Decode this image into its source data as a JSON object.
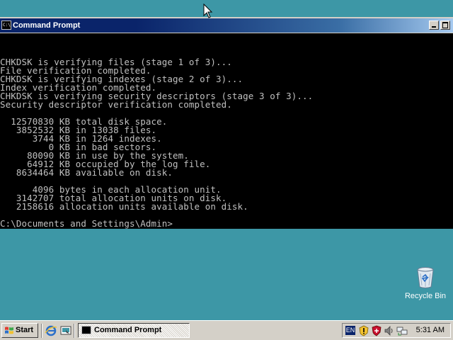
{
  "window": {
    "title": "Command Prompt",
    "icon": "cmd-icon"
  },
  "console": {
    "text": "CHKDSK is verifying files (stage 1 of 3)...\nFile verification completed.\nCHKDSK is verifying indexes (stage 2 of 3)...\nIndex verification completed.\nCHKDSK is verifying security descriptors (stage 3 of 3)...\nSecurity descriptor verification completed.\n\n  12570830 KB total disk space.\n   3852532 KB in 13038 files.\n      3744 KB in 1264 indexes.\n         0 KB in bad sectors.\n     80090 KB in use by the system.\n     64912 KB occupied by the log file.\n   8634464 KB available on disk.\n\n      4096 bytes in each allocation unit.\n   3142707 total allocation units on disk.\n   2158616 allocation units available on disk.\n\nC:\\Documents and Settings\\Admin>"
  },
  "desktop": {
    "recycle_bin_label": "Recycle Bin"
  },
  "taskbar": {
    "start_label": "Start",
    "task_label": "Command Prompt",
    "language": "EN",
    "clock": "5:31 AM"
  },
  "colors": {
    "desktop": "#3d97a6",
    "titlebar_start": "#0a246a",
    "titlebar_end": "#a6caf0",
    "console_bg": "#000000",
    "console_fg": "#c0c0c0",
    "taskbar": "#d4d0c8"
  }
}
